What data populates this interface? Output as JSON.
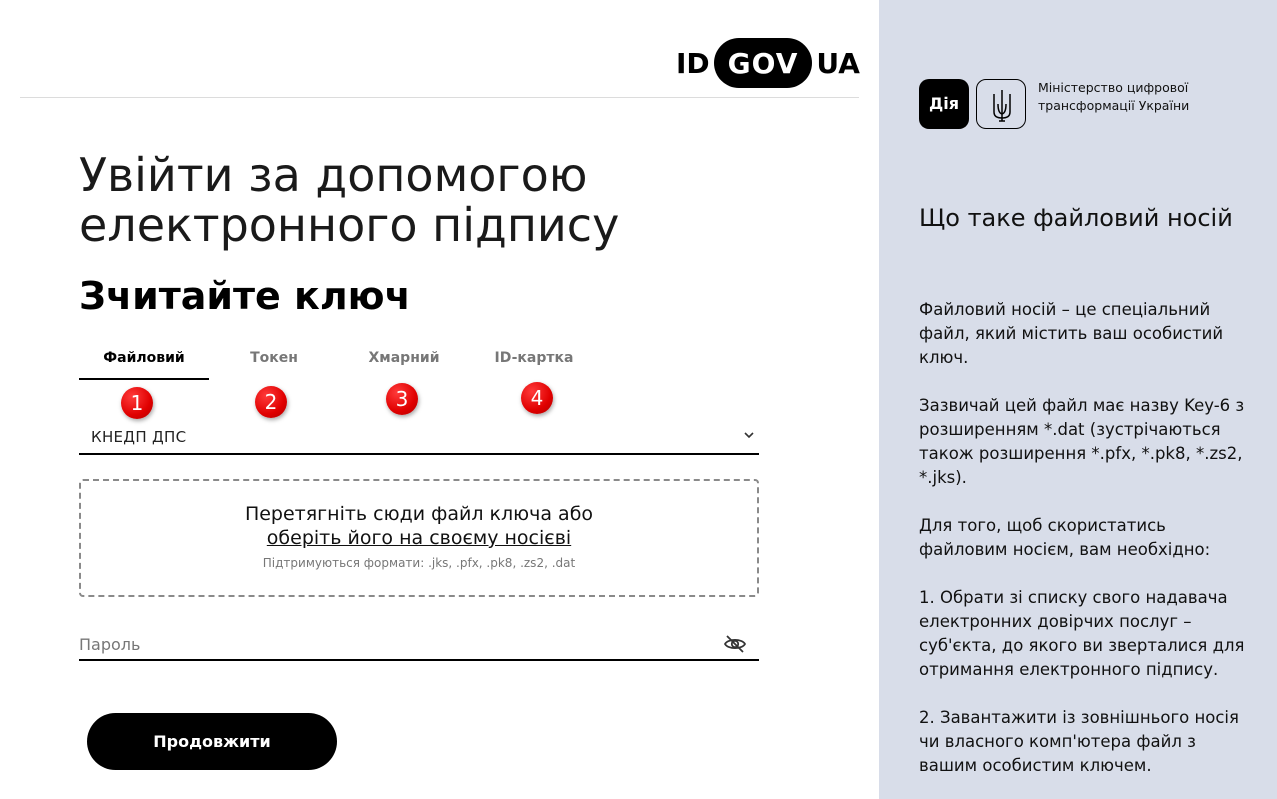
{
  "logo": {
    "left": "ID",
    "pill": "GOV",
    "right": "UA"
  },
  "title": "Увійти за допомогою електронного підпису",
  "subtitle": "Зчитайте ключ",
  "tabs": [
    {
      "label": "Файловий",
      "active": true
    },
    {
      "label": "Токен",
      "active": false
    },
    {
      "label": "Хмарний",
      "active": false
    },
    {
      "label": "ID-картка",
      "active": false
    }
  ],
  "markers": [
    "1",
    "2",
    "3",
    "4"
  ],
  "provider_select": {
    "value": "КНЕДП ДПС"
  },
  "dropzone": {
    "line1": "Перетягніть сюди файл ключа або",
    "link": "оберіть його на своєму носієві",
    "formats": "Підтримуються формати: .jks, .pfx, .pk8, .zs2, .dat"
  },
  "password": {
    "placeholder": "Пароль",
    "value": ""
  },
  "continue_button": "Продовжити",
  "sidebar": {
    "diya_logo": "Дія",
    "ministry": "Міністерство цифрової трансформації України",
    "heading": "Що таке файловий носій",
    "paragraphs": [
      "Файловий носій – це спеціальний файл, який містить ваш особистий ключ.",
      "Зазвичай цей файл має назву Key-6 з розширенням *.dat (зустрічаються також розширення *.pfx, *.pk8, *.zs2, *.jks).",
      "Для того, щоб скористатись файловим носієм, вам необхідно:",
      "1. Обрати зі списку свого надавача електронних довірчих послуг – суб'єкта, до якого ви зверталися для отримання електронного підпису.",
      "2. Завантажити із зовнішнього носія чи власного комп'ютера файл з вашим особистим ключем."
    ]
  }
}
